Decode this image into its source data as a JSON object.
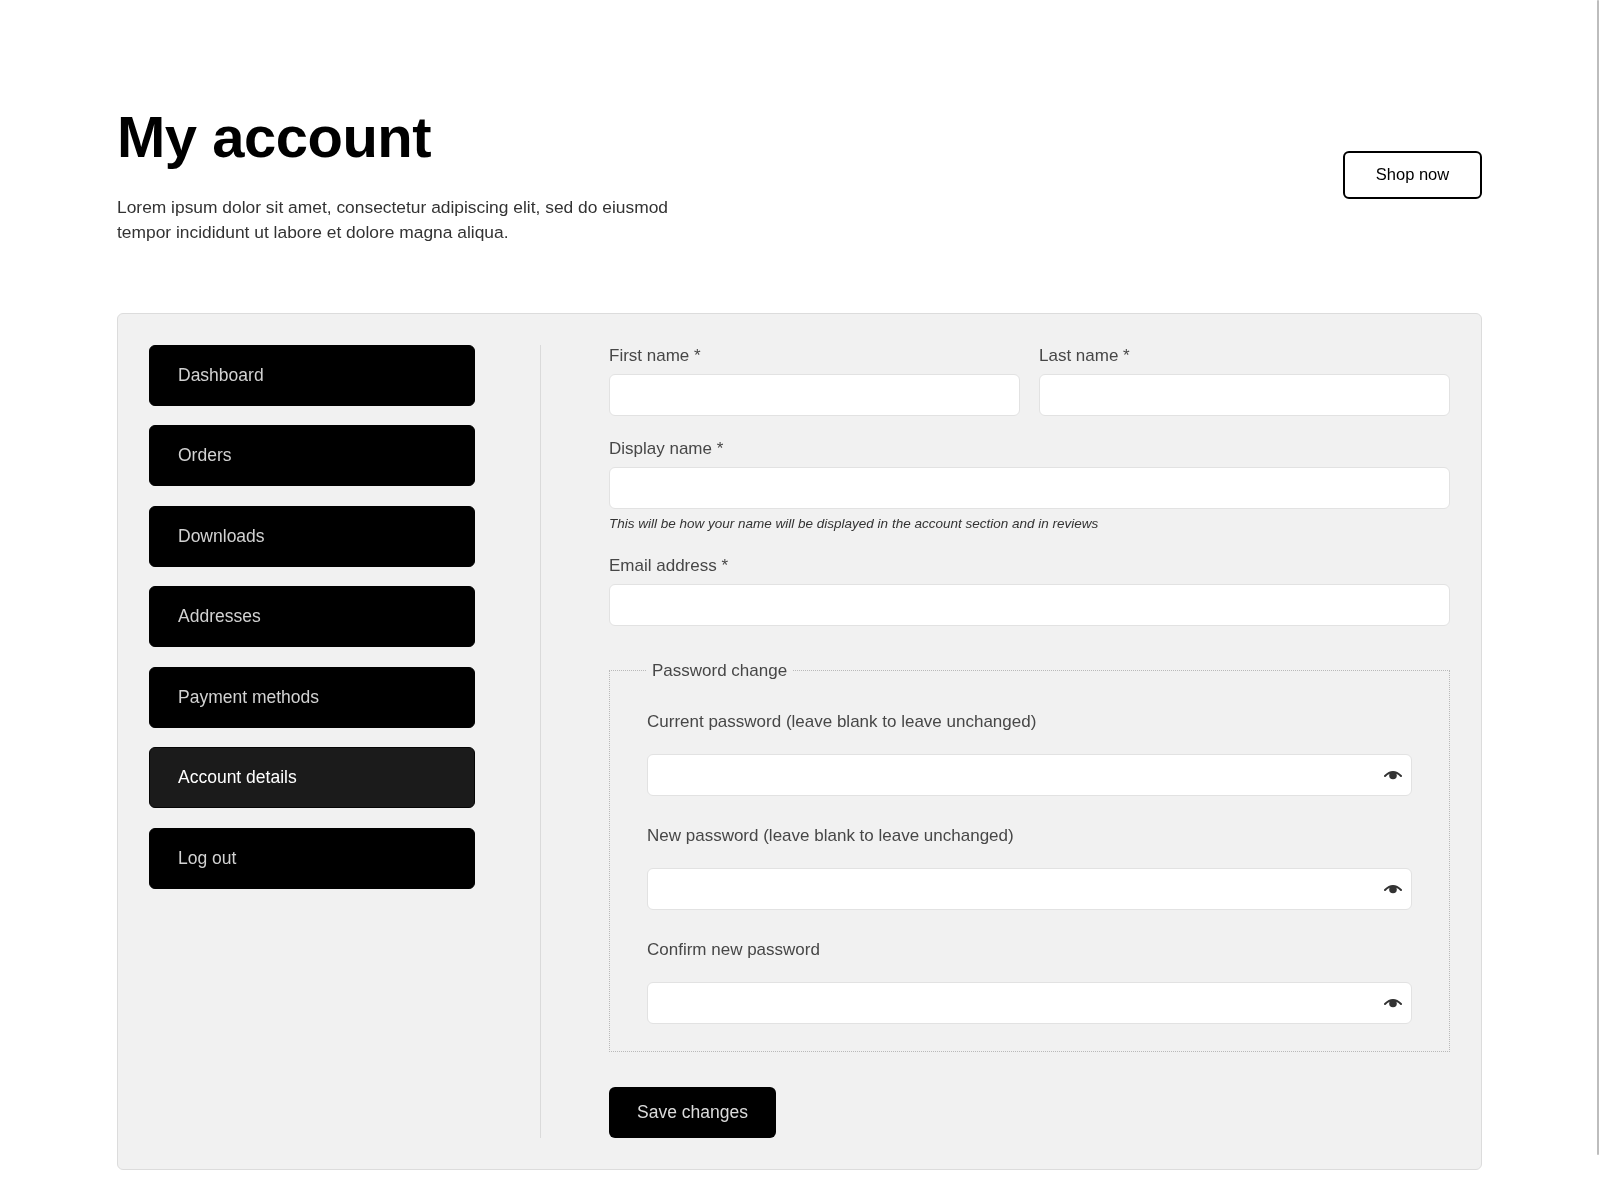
{
  "header": {
    "title": "My account",
    "description": "Lorem ipsum dolor sit amet, consectetur adipiscing elit, sed do eiusmod tempor incididunt ut labore et dolore magna aliqua.",
    "shop_button": "Shop now"
  },
  "nav": {
    "items": [
      {
        "label": "Dashboard",
        "selected": false
      },
      {
        "label": "Orders",
        "selected": false
      },
      {
        "label": "Downloads",
        "selected": false
      },
      {
        "label": "Addresses",
        "selected": false
      },
      {
        "label": "Payment methods",
        "selected": false
      },
      {
        "label": "Account details",
        "selected": true
      },
      {
        "label": "Log out",
        "selected": false
      }
    ]
  },
  "form": {
    "fields": [
      {
        "kind": "half",
        "label": "First name *"
      },
      {
        "kind": "half",
        "label": "Last name *"
      },
      {
        "kind": "full",
        "label": "Display name *",
        "hint": "This will be how your name will be displayed in the account section and in reviews"
      },
      {
        "kind": "full",
        "label": "Email address *"
      }
    ],
    "password_change": {
      "legend": "Password change",
      "fields": [
        {
          "label": "Current password (leave blank to leave unchanged)"
        },
        {
          "label": "New password (leave blank to leave unchanged)"
        },
        {
          "label": "Confirm new password"
        }
      ]
    },
    "submit": "Save changes"
  }
}
